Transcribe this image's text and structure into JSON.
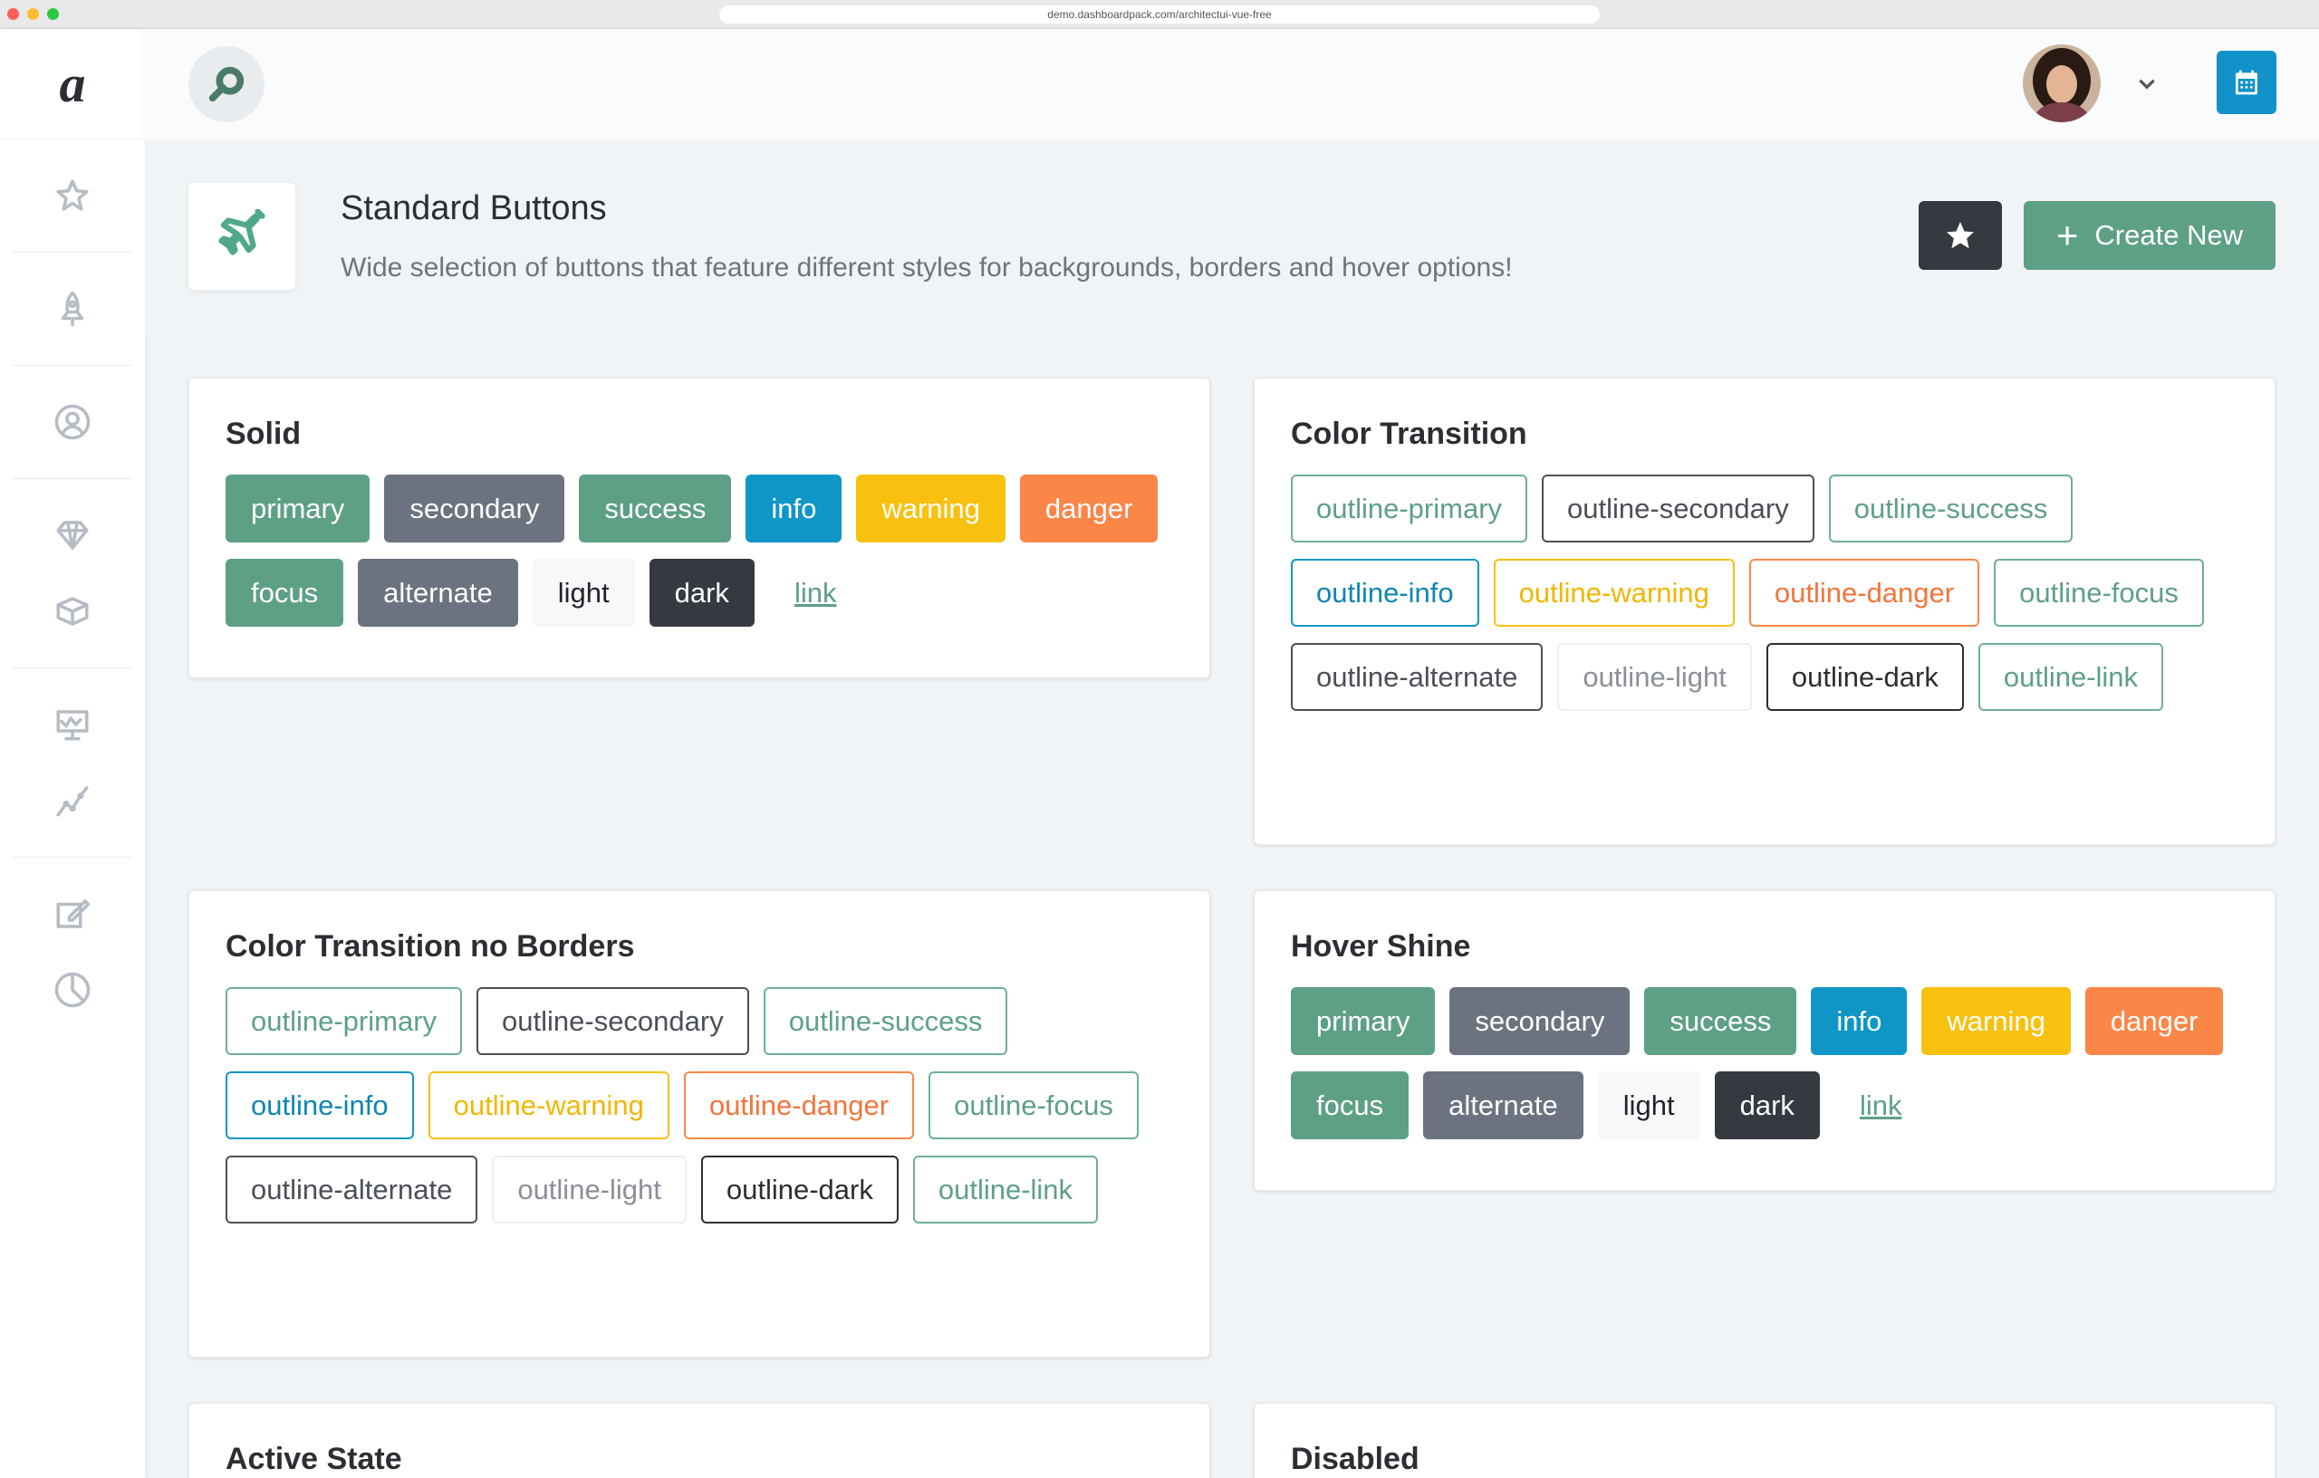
{
  "browser": {
    "url": "demo.dashboardpack.com/architectui-vue-free"
  },
  "sidebar": {
    "logo": "a",
    "icons": [
      "star-icon",
      "rocket-icon",
      "user-icon",
      "diamond-icon",
      "box-icon",
      "presentation-icon",
      "chart-line-icon",
      "pencil-icon",
      "pie-chart-icon"
    ]
  },
  "header": {
    "search_icon": "search-icon",
    "user_chevron": "chevron-down-icon",
    "calendar_icon": "calendar-icon"
  },
  "page": {
    "title": "Standard Buttons",
    "subtitle": "Wide selection of buttons that feature different styles for backgrounds, borders and hover options!",
    "create_label": "Create New",
    "create_icon": "plus",
    "accent_color": "#5ea086"
  },
  "cards": {
    "solid": {
      "title": "Solid",
      "buttons": [
        "primary",
        "secondary",
        "success",
        "info",
        "warning",
        "danger",
        "focus",
        "alternate",
        "light",
        "dark",
        "link"
      ]
    },
    "color_transition": {
      "title": "Color Transition",
      "buttons": [
        "outline-primary",
        "outline-secondary",
        "outline-success",
        "outline-info",
        "outline-warning",
        "outline-danger",
        "outline-focus",
        "outline-alternate",
        "outline-light",
        "outline-dark",
        "outline-link"
      ]
    },
    "no_borders": {
      "title": "Color Transition no Borders",
      "buttons": [
        "outline-primary",
        "outline-secondary",
        "outline-success",
        "outline-info",
        "outline-warning",
        "outline-danger",
        "outline-focus",
        "outline-alternate",
        "outline-light",
        "outline-dark",
        "outline-link"
      ]
    },
    "hover_shine": {
      "title": "Hover Shine",
      "buttons": [
        "primary",
        "secondary",
        "success",
        "info",
        "warning",
        "danger",
        "focus",
        "alternate",
        "light",
        "dark",
        "link"
      ]
    },
    "active_state": {
      "title": "Active State"
    },
    "disabled": {
      "title": "Disabled"
    }
  }
}
